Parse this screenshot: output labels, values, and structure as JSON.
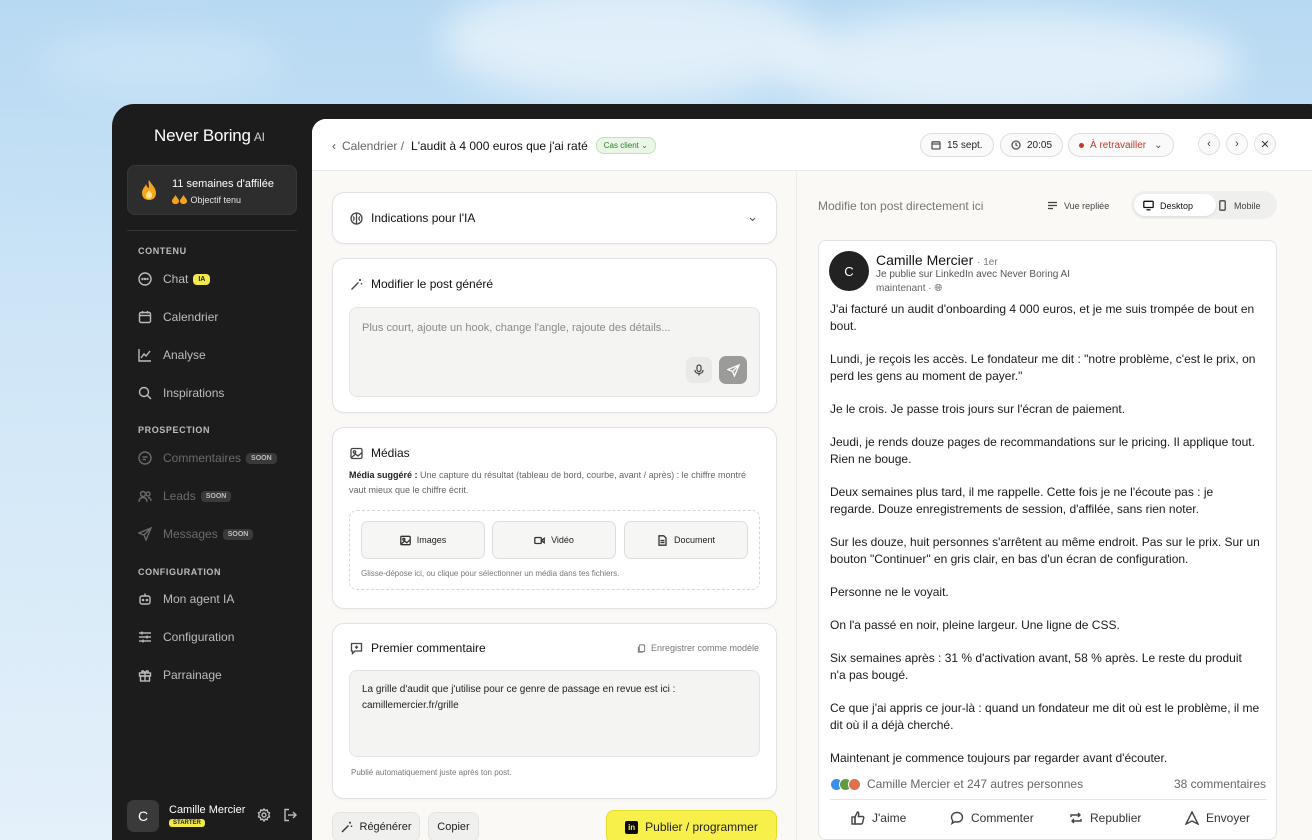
{
  "brand": {
    "name": "Never Boring",
    "suffix": "AI"
  },
  "streak": {
    "title": "11 semaines d'affilée",
    "subtitle": "Objectif tenu"
  },
  "sidebar": {
    "sections": {
      "content": "CONTENU",
      "prospection": "PROSPECTION",
      "configuration": "CONFIGURATION"
    },
    "items": [
      {
        "label": "Chat",
        "badge": "IA"
      },
      {
        "label": "Calendrier"
      },
      {
        "label": "Analyse"
      },
      {
        "label": "Inspirations"
      },
      {
        "label": "Commentaires",
        "badge": "SOON"
      },
      {
        "label": "Leads",
        "badge": "SOON"
      },
      {
        "label": "Messages",
        "badge": "SOON"
      },
      {
        "label": "Mon agent IA"
      },
      {
        "label": "Configuration"
      },
      {
        "label": "Parrainage"
      }
    ]
  },
  "user": {
    "initial": "C",
    "name": "Camille Mercier",
    "plan": "STARTER"
  },
  "topbar": {
    "parent": "Calendrier /",
    "title": "L'audit à 4 000 euros que j'ai raté",
    "tag": "Cas client",
    "date": "15 sept.",
    "time": "20:05",
    "status": "À retravailler"
  },
  "ai_hints": {
    "title": "Indications pour l'IA"
  },
  "edit": {
    "title": "Modifier le post généré",
    "placeholder": "Plus court, ajoute un hook, change l'angle, rajoute des détails..."
  },
  "media": {
    "title": "Médias",
    "suggested_label": "Média suggéré :",
    "suggested_text": "Une capture du résultat (tableau de bord, courbe, avant / après) : le chiffre montré vaut mieux que le chiffre écrit.",
    "buttons": [
      "Images",
      "Vidéo",
      "Document"
    ],
    "drop_hint": "Glisse-dépose ici, ou clique pour sélectionner un média dans tes fichiers."
  },
  "comment": {
    "title": "Premier commentaire",
    "save_template": "Enregistrer comme modèle",
    "value": "La grille d'audit que j'utilise pour ce genre de passage en revue est ici : camillemercier.fr/grille",
    "footnote": "Publié automatiquement juste après ton post."
  },
  "actions": {
    "regenerate": "Régénérer",
    "copy": "Copier",
    "publish": "Publier / programmer"
  },
  "preview": {
    "hint": "Modifie ton post directement ici",
    "view_folded": "Vue repliée",
    "desktop": "Desktop",
    "mobile": "Mobile"
  },
  "post": {
    "initial": "C",
    "author": "Camille Mercier",
    "degree": "· 1er",
    "subtitle": "Je publie sur LinkedIn avec Never Boring AI",
    "time": "maintenant ·",
    "paragraphs": [
      "J'ai facturé un audit d'onboarding 4 000 euros, et je me suis trompée de bout en bout.",
      "Lundi, je reçois les accès. Le fondateur me dit : \"notre problème, c'est le prix, on perd les gens au moment de payer.\"",
      "Je le crois. Je passe trois jours sur l'écran de paiement.",
      "Jeudi, je rends douze pages de recommandations sur le pricing. Il applique tout. Rien ne bouge.",
      "Deux semaines plus tard, il me rappelle. Cette fois je ne l'écoute pas : je regarde. Douze enregistrements de session, d'affilée, sans rien noter.",
      "Sur les douze, huit personnes s'arrêtent au même endroit. Pas sur le prix. Sur un bouton \"Continuer\" en gris clair, en bas d'un écran de configuration.",
      "Personne ne le voyait.",
      "On l'a passé en noir, pleine largeur. Une ligne de CSS.",
      "Six semaines après : 31 % d'activation avant, 58 % après. Le reste du produit n'a pas bougé.",
      "Ce que j'ai appris ce jour-là : quand un fondateur me dit où est le problème, il me dit où il a déjà cherché.",
      "Maintenant je commence toujours par regarder avant d'écouter."
    ],
    "reactions": "Camille Mercier et 247 autres personnes",
    "comments": "38 commentaires",
    "actions": [
      "J'aime",
      "Commenter",
      "Republier",
      "Envoyer"
    ]
  },
  "colors": {
    "accent": "#f7f04a",
    "warn": "#c0392b",
    "sidebar": "#1c1c1c"
  }
}
